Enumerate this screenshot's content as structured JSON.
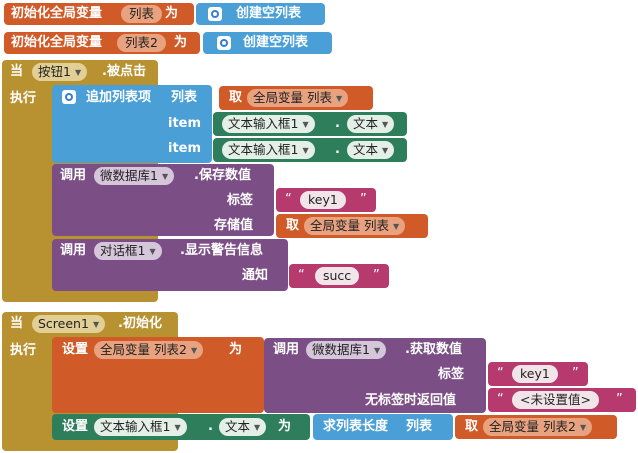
{
  "globals": [
    {
      "keyword": "初始化全局变量",
      "name": "列表",
      "to": "为",
      "value": "创建空列表"
    },
    {
      "keyword": "初始化全局变量",
      "name": "列表2",
      "to": "为",
      "value": "创建空列表"
    }
  ],
  "event1": {
    "when": "当",
    "component": "按钮1",
    "event": ".被点击",
    "do": "执行",
    "add": {
      "label": "追加列表项",
      "list_label": "列表",
      "get": "取",
      "get_var": "全局变量 列表",
      "items": [
        {
          "label": "item",
          "component": "文本输入框1",
          "dot": ".",
          "prop": "文本"
        },
        {
          "label": "item",
          "component": "文本输入框1",
          "dot": ".",
          "prop": "文本"
        }
      ]
    },
    "store": {
      "call": "调用",
      "component": "微数据库1",
      "method": ".保存数值",
      "tag_label": "标签",
      "tag_value": "key1",
      "value_label": "存储值",
      "get": "取",
      "get_var": "全局变量 列表"
    },
    "alert": {
      "call": "调用",
      "component": "对话框1",
      "method": ".显示警告信息",
      "notice_label": "通知",
      "notice_value": "succ"
    }
  },
  "event2": {
    "when": "当",
    "component": "Screen1",
    "event": ".初始化",
    "do": "执行",
    "set1": {
      "set": "设置",
      "var": "全局变量 列表2",
      "to": "为",
      "call": "调用",
      "component": "微数据库1",
      "method": ".获取数值",
      "tag_label": "标签",
      "tag_value": "key1",
      "default_label": "无标签时返回值",
      "default_value": "<未设置值>"
    },
    "set2": {
      "set": "设置",
      "component": "文本输入框1",
      "dot": ".",
      "prop": "文本",
      "to": "为",
      "length_label": "求列表长度",
      "list_label": "列表",
      "get": "取",
      "get_var": "全局变量 列表2"
    }
  },
  "quote_open": "“",
  "quote_close": "”",
  "dropdown_icon": "▼",
  "colors": {
    "variable": "#d05a28",
    "list": "#4a9fd6",
    "event": "#b89130",
    "text_prop": "#2e7d5b",
    "procedure": "#7b4f86",
    "text": "#b63a6d"
  }
}
